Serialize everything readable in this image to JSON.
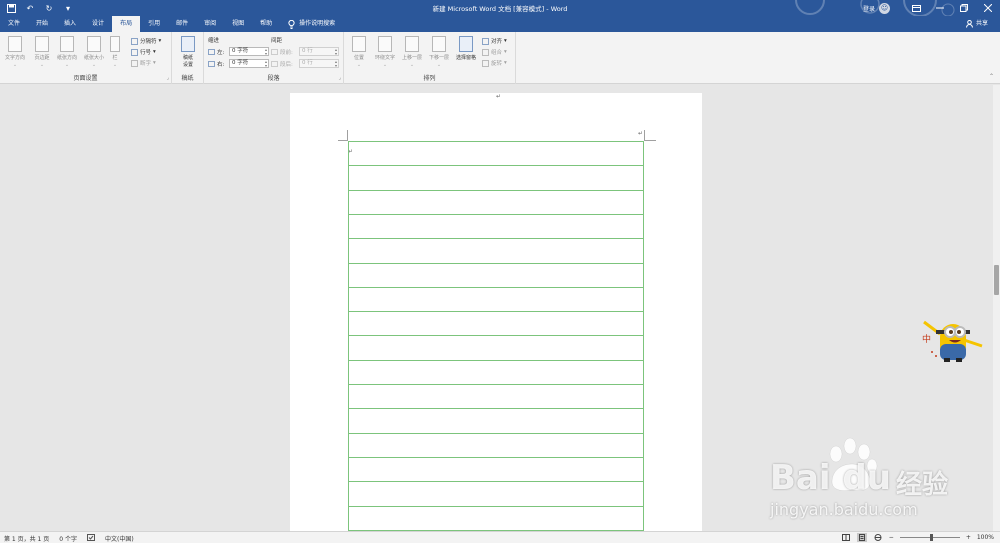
{
  "titlebar": {
    "doc_title": "新建 Microsoft Word 文档 [兼容模式]  -  Word",
    "signin_label": "登录",
    "avatar_glyph": "☺"
  },
  "tabs": [
    {
      "label": "文件",
      "active": false
    },
    {
      "label": "开始",
      "active": false
    },
    {
      "label": "插入",
      "active": false
    },
    {
      "label": "设计",
      "active": false
    },
    {
      "label": "布局",
      "active": true
    },
    {
      "label": "引用",
      "active": false
    },
    {
      "label": "邮件",
      "active": false
    },
    {
      "label": "审阅",
      "active": false
    },
    {
      "label": "视图",
      "active": false
    },
    {
      "label": "帮助",
      "active": false
    }
  ],
  "tellme_label": "操作说明搜索",
  "share_label": "共享",
  "ribbon": {
    "page_setup": {
      "label": "页面设置",
      "text_direction": "文字方向",
      "margins": "页边距",
      "orientation": "纸张方向",
      "size": "纸张大小",
      "columns": "栏",
      "breaks": "分隔符",
      "line_numbers": "行号",
      "hyphenation": "断字"
    },
    "manuscript": {
      "label": "稿纸",
      "button": "稿纸\n设置"
    },
    "paragraph": {
      "label": "段落",
      "indent_head": "缩进",
      "spacing_head": "间距",
      "left_label": "左:",
      "right_label": "右:",
      "before_label": "段前:",
      "after_label": "段后:",
      "left_value": "0 字符",
      "right_value": "0 字符",
      "before_value": "0 行",
      "after_value": "0 行"
    },
    "arrange": {
      "label": "排列",
      "position": "位置",
      "wrap_text": "环绕文字",
      "bring_forward": "上移一层",
      "send_backward": "下移一层",
      "selection_pane": "选择窗格",
      "align": "对齐",
      "group": "组合",
      "rotate": "旋转"
    }
  },
  "status": {
    "page": "第 1 页，共 1 页",
    "words": "0 个字",
    "language": "中文(中国)",
    "zoom": "100%",
    "zoom_minus": "−",
    "zoom_plus": "+"
  },
  "mascot_char": "中",
  "watermark": {
    "brand": "Bai du",
    "brand_cn": "经验",
    "url": "jingyan.baidu.com"
  },
  "colors": {
    "word_blue": "#2b579a",
    "grid_green": "#7cc47c"
  }
}
